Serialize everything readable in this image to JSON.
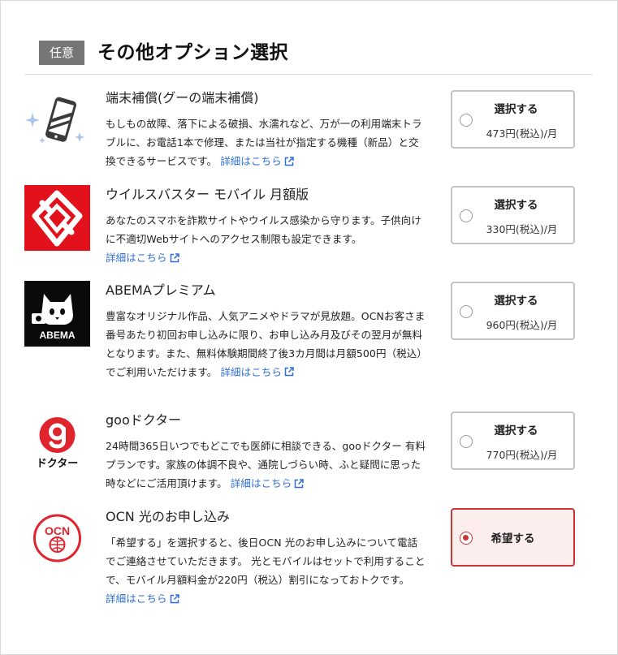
{
  "header": {
    "badge": "任意",
    "title": "その他オプション選択"
  },
  "detail_link_label": "詳細はこちら",
  "colors": {
    "accent": "#c9353b",
    "link": "#2f6fd4",
    "badge_bg": "#767676"
  },
  "options": [
    {
      "title": "端末補償(グーの端末補償)",
      "description": "もしもの故障、落下による破損、水濡れなど、万が一の利用端末トラブルに、お電話1本で修理、または当社が指定する機種（新品）と交換できるサービスです。",
      "button_label": "選択する",
      "price": "473円(税込)/月",
      "selected": false,
      "icon": "phone-sparkle-icon"
    },
    {
      "title": "ウイルスバスター モバイル 月額版",
      "description": "あなたのスマホを詐欺サイトやウイルス感染から守ります。子供向けに不適切Webサイトへのアクセス制限も設定できます。",
      "button_label": "選択する",
      "price": "330円(税込)/月",
      "selected": false,
      "icon": "virusbuster-logo"
    },
    {
      "title": "ABEMAプレミアム",
      "description": "豊富なオリジナル作品、人気アニメやドラマが見放題。OCNお客さま番号あたり初回お申し込みに限り、お申し込み月及びその翌月が無料となります。また、無料体験期間終了後3カ月間は月額500円（税込）でご利用いただけます。",
      "logo_text": "ABEMA",
      "button_label": "選択する",
      "price": "960円(税込)/月",
      "selected": false,
      "icon": "abema-logo"
    },
    {
      "title": "gooドクター",
      "description": "24時間365日いつでもどこでも医師に相談できる、gooドクター 有料プランです。家族の体調不良や、通院しづらい時、ふと疑問に思った時などにご活用頂けます。",
      "logo_text": "ドクター",
      "button_label": "選択する",
      "price": "770円(税込)/月",
      "selected": false,
      "icon": "goo-doctor-logo"
    },
    {
      "title": "OCN 光のお申し込み",
      "description": "「希望する」を選択すると、後日OCN 光のお申し込みについて電話でご連絡させていただきます。 光とモバイルはセットで利用することで、モバイル月額料金が220円（税込）割引になっておトクです。",
      "logo_text": "OCN",
      "button_label": "希望する",
      "price": "",
      "selected": true,
      "icon": "ocn-hikari-logo"
    }
  ]
}
